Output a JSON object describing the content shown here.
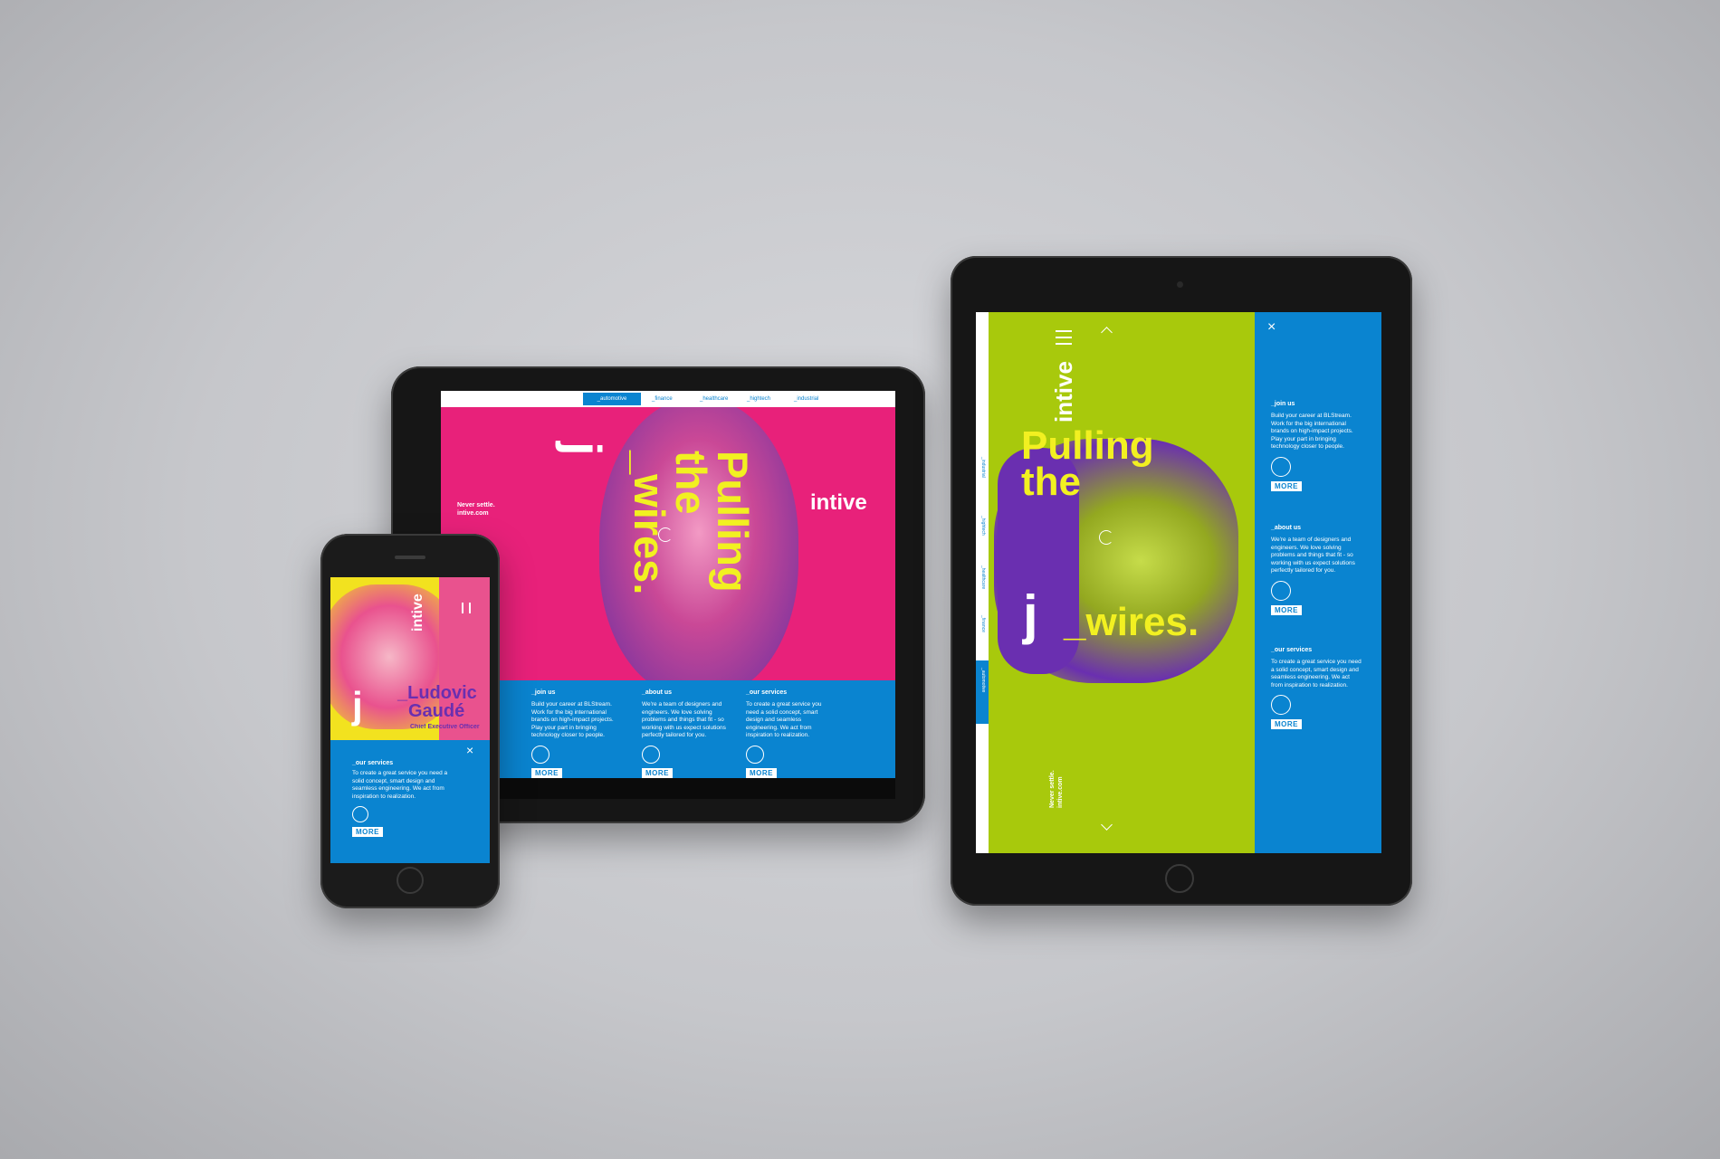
{
  "landscape_tablet": {
    "nav": [
      "_automotive",
      "_finance",
      "_healthcare",
      "_hightech",
      "_industrial"
    ],
    "active_nav_index": 0,
    "tagline_line1": "Never settle.",
    "tagline_line2": "intive.com",
    "logo": "intive",
    "headline_line1": "Pulling",
    "headline_line2": "the",
    "headline_line3": "_wires.",
    "j_glyph": "j",
    "columns": [
      {
        "title": "_join us",
        "body": "Build your career at BLStream. Work for the big international brands on high-impact projects. Play your part in bringing technology closer to people.",
        "icon": "shirt-icon",
        "more": "MORE"
      },
      {
        "title": "_about us",
        "body": "We're a team of designers and engineers. We love solving problems and things that fit - so working with us expect solutions perfectly tailored for you.",
        "icon": "people-icon",
        "more": "MORE"
      },
      {
        "title": "_our services",
        "body": "To create a great service you need a solid concept, smart design and seamless engineering. We act from inspiration to realization.",
        "icon": "gear-icon",
        "more": "MORE"
      }
    ],
    "colors": {
      "magenta": "#e8217a",
      "blue": "#0a84d0",
      "yellow": "#f2f021"
    }
  },
  "portrait_tablet": {
    "logo": "intive",
    "headline_line1": "Pulling",
    "headline_line2": "the",
    "headline_line3": "_wires.",
    "j_glyph": "j",
    "side_nav": [
      "_industrial",
      "_hightech",
      "_healthcare",
      "_finance",
      "_automotive"
    ],
    "active_side_nav_index": 4,
    "tagline_line1": "Never settle.",
    "tagline_line2": "intive.com",
    "close_glyph": "×",
    "panel_items": [
      {
        "title": "_join us",
        "body": "Build your career at BLStream. Work for the big international brands on high-impact projects. Play your part in bringing technology closer to people.",
        "icon": "shirt-icon",
        "more": "MORE"
      },
      {
        "title": "_about us",
        "body": "We're a team of designers and engineers. We love solving problems and things that fit - so working with us expect solutions perfectly tailored for you.",
        "icon": "people-icon",
        "more": "MORE"
      },
      {
        "title": "_our services",
        "body": "To create a great service you need a solid concept, smart design and seamless engineering. We act from inspiration to realization.",
        "icon": "gear-icon",
        "more": "MORE"
      }
    ],
    "colors": {
      "lime": "#a8c90c",
      "purple": "#6a2fb0",
      "blue": "#0a84d0",
      "yellow": "#f2f021"
    }
  },
  "phone": {
    "logo": "intive",
    "name_line1": "_Ludovic",
    "name_line2": "Gaudé",
    "role": "Chief Executive Officer",
    "j_glyph": "j",
    "close_glyph": "×",
    "panel_title": "_our services",
    "panel_body": "To create a great service you need a solid concept, smart design and seamless engineering. We act from inspiration to realization.",
    "panel_icon": "gear-icon",
    "more": "MORE",
    "colors": {
      "yellow": "#f2e21f",
      "pink": "#e9528e",
      "blue": "#0a84d0",
      "purple": "#6a2fb0"
    }
  }
}
